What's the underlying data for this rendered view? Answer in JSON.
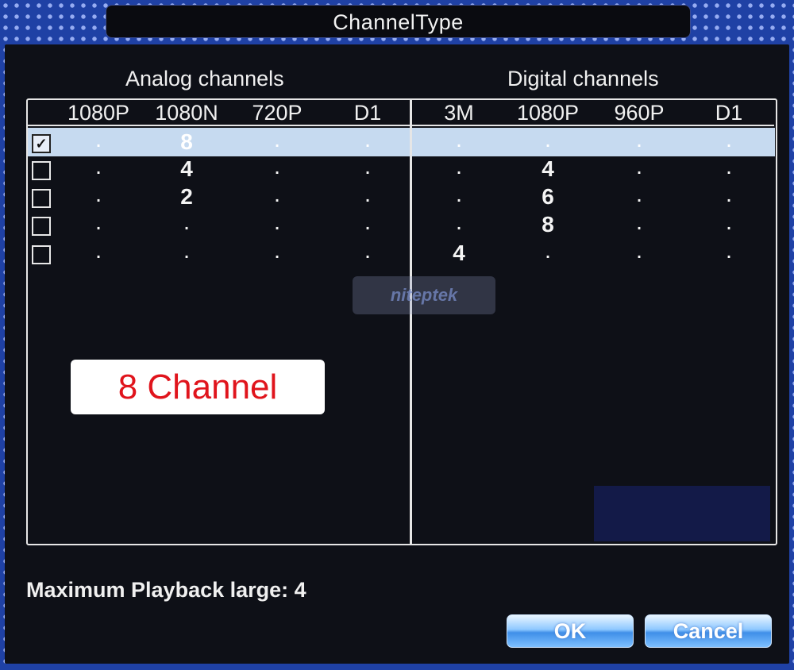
{
  "window": {
    "title": "ChannelType"
  },
  "sections": {
    "analog_title": "Analog channels",
    "digital_title": "Digital channels"
  },
  "columns": {
    "analog": [
      "1080P",
      "1080N",
      "720P",
      "D1"
    ],
    "digital": [
      "3M",
      "1080P",
      "960P",
      "D1"
    ]
  },
  "rows": [
    {
      "checked": true,
      "analog": [
        ".",
        "8",
        ".",
        "."
      ],
      "digital": [
        ".",
        ".",
        ".",
        "."
      ]
    },
    {
      "checked": false,
      "analog": [
        ".",
        "4",
        ".",
        "."
      ],
      "digital": [
        ".",
        "4",
        ".",
        "."
      ]
    },
    {
      "checked": false,
      "analog": [
        ".",
        "2",
        ".",
        "."
      ],
      "digital": [
        ".",
        "6",
        ".",
        "."
      ]
    },
    {
      "checked": false,
      "analog": [
        ".",
        ".",
        ".",
        "."
      ],
      "digital": [
        ".",
        "8",
        ".",
        "."
      ]
    },
    {
      "checked": false,
      "analog": [
        ".",
        ".",
        ".",
        "."
      ],
      "digital": [
        "4",
        ".",
        ".",
        "."
      ]
    }
  ],
  "check_mark": "✓",
  "overlay_label": "8 Channel",
  "watermark_text": "niteptek",
  "status": {
    "playback": "Maximum Playback large: 4"
  },
  "buttons": {
    "ok": "OK",
    "cancel": "Cancel"
  }
}
